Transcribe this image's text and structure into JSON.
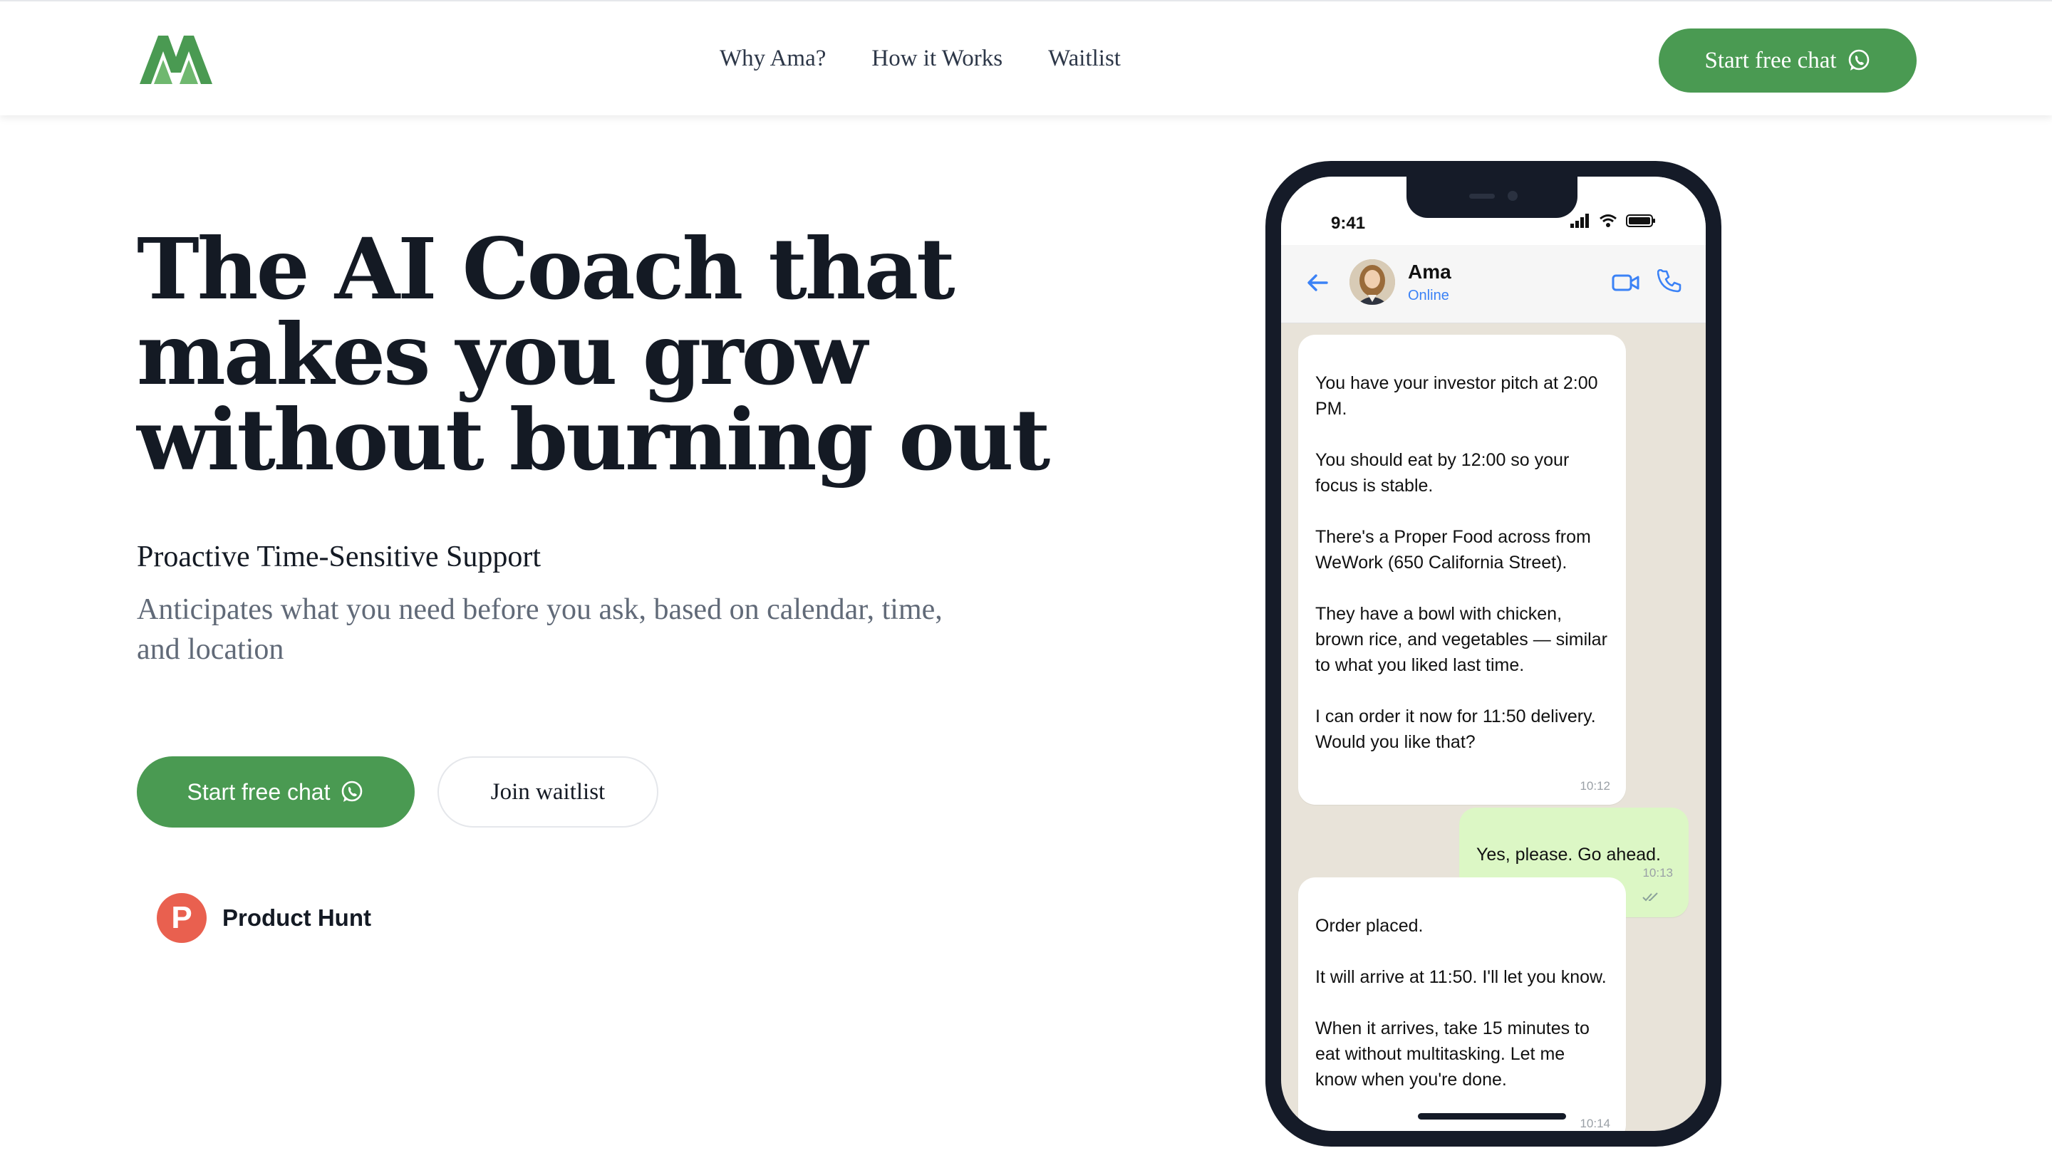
{
  "header": {
    "logo_alt": "AM logo",
    "nav": [
      "Why Ama?",
      "How it Works",
      "Waitlist"
    ],
    "cta_label": "Start free chat"
  },
  "hero": {
    "title_lines": [
      "The AI Coach that",
      "makes you grow",
      "without burning out"
    ],
    "subheading": "Proactive Time-Sensitive Support",
    "description": "Anticipates what you need before you ask, based on calendar, time, and location",
    "primary_cta": "Start free chat",
    "secondary_cta": "Join waitlist",
    "badge_letter": "P",
    "badge_label": "Product Hunt"
  },
  "phone": {
    "time": "9:41",
    "contact_name": "Ama",
    "contact_status": "Online",
    "messages": [
      {
        "from": "ama",
        "text": "You have your investor pitch at 2:00 PM.\n\nYou should eat by 12:00 so your focus is stable.\n\nThere's a Proper Food across from WeWork (650 California Street).\n\nThey have a bowl with chicken, brown rice, and vegetables — similar to what you liked last time.\n\nI can order it now for 11:50 delivery. Would you like that?",
        "time": "10:12"
      },
      {
        "from": "user",
        "text": "Yes, please. Go ahead.",
        "time": "10:13"
      },
      {
        "from": "ama",
        "text": "Order placed.\n\nIt will arrive at 11:50. I'll let you know.\n\nWhen it arrives, take 15 minutes to eat without multitasking. Let me know when you're done.",
        "time": "10:14"
      }
    ]
  },
  "colors": {
    "brand_green": "#4a9a52",
    "ink": "#141a24",
    "muted": "#616a78",
    "product_hunt": "#e9604f",
    "chat_bg": "#e8e3d9",
    "outgoing_bubble": "#dcf7c5"
  }
}
